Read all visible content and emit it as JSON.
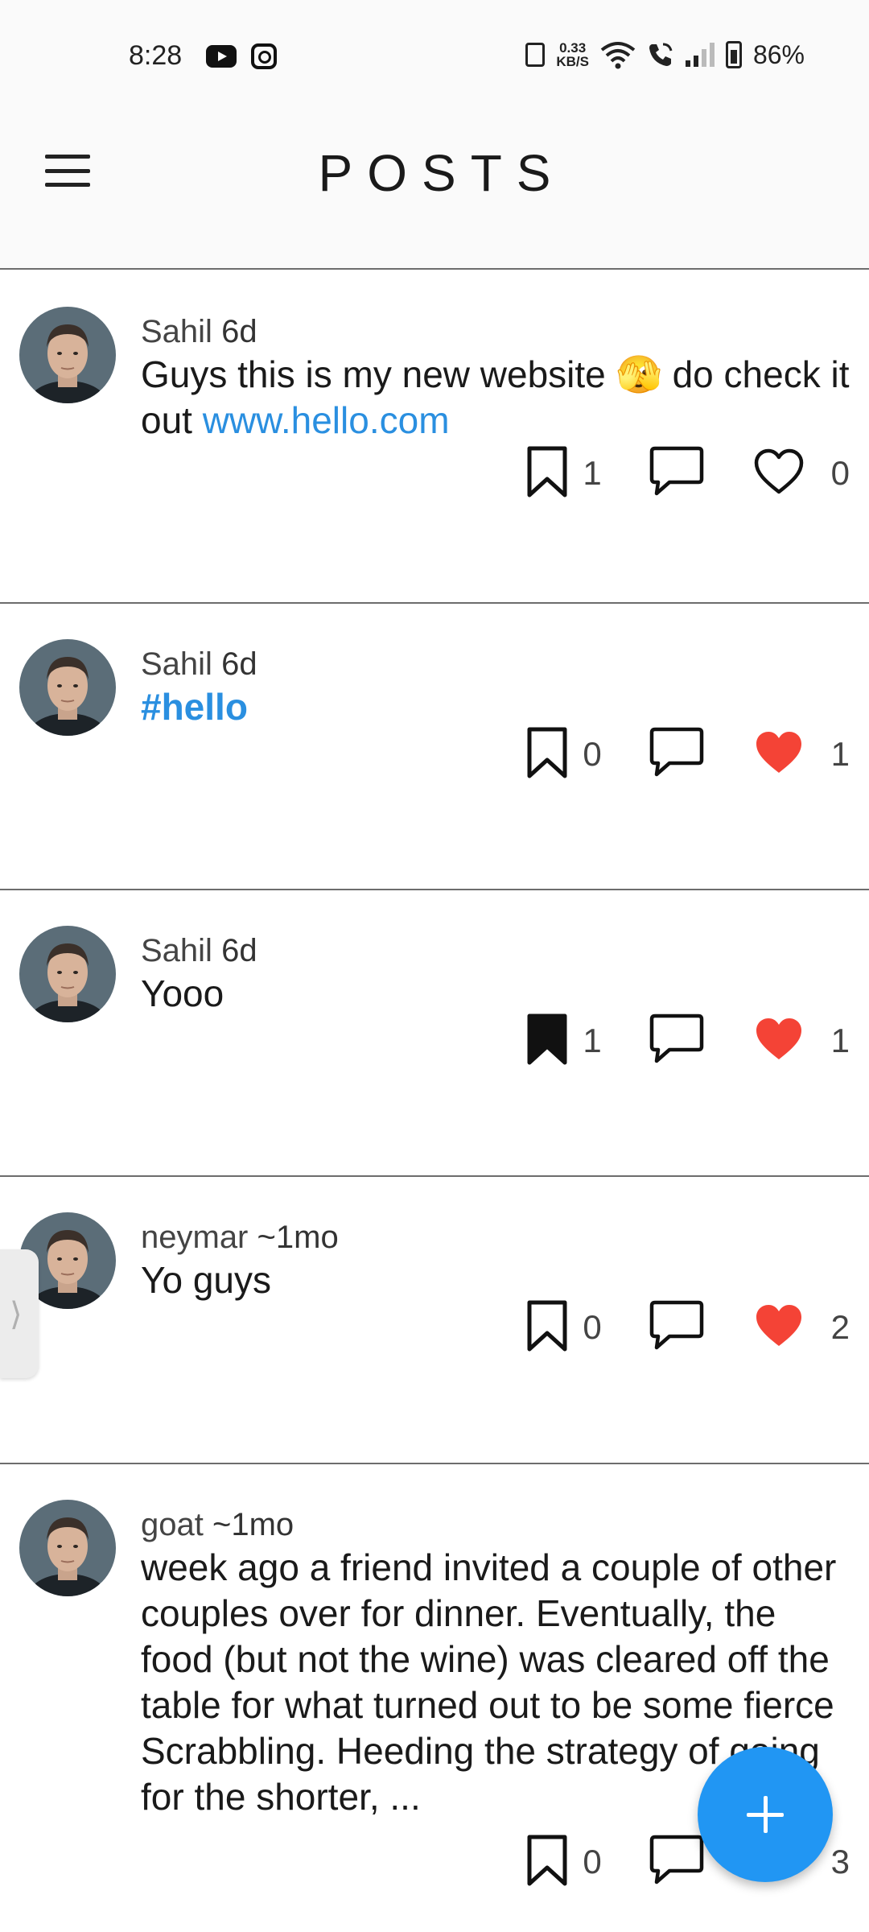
{
  "status_bar": {
    "time": "8:28",
    "net_speed_value": "0.33",
    "net_speed_unit": "KB/S",
    "battery": "86%",
    "icons": [
      "youtube-icon",
      "instagram-icon",
      "vibrate-icon",
      "wifi-icon",
      "wifi-call-icon",
      "signal-icon",
      "battery-icon"
    ]
  },
  "header": {
    "title": "POSTS",
    "menu_icon": "hamburger-menu-icon"
  },
  "colors": {
    "accent": "#2196f3",
    "link": "#2a8fe0",
    "like_active": "#f44336"
  },
  "posts": [
    {
      "author": "Sahil",
      "ago": "6d",
      "text_before": "Guys this is my new website 🫣 do check it out ",
      "link": "www.hello.com",
      "bookmarks": "1",
      "likes": "0",
      "bookmarked": false,
      "liked": false
    },
    {
      "author": "Sahil",
      "ago": "6d",
      "hashtag": "#hello",
      "bookmarks": "0",
      "likes": "1",
      "bookmarked": false,
      "liked": true
    },
    {
      "author": "Sahil",
      "ago": "6d",
      "text": "Yooo",
      "bookmarks": "1",
      "likes": "1",
      "bookmarked": true,
      "liked": true
    },
    {
      "author": "neymar",
      "ago": "~1mo",
      "text": "Yo guys",
      "bookmarks": "0",
      "likes": "2",
      "bookmarked": false,
      "liked": true
    },
    {
      "author": "goat",
      "ago": "~1mo",
      "text": "week ago a friend invited a couple of other couples over for dinner. Eventually, the food (but not the wine) was cleared off the table for what turned out to be some fierce Scrabbling. Heeding the strategy of going for the shorter, ...",
      "bookmarks": "0",
      "likes": "3",
      "bookmarked": false,
      "liked": true
    }
  ],
  "fab": {
    "icon": "plus-icon"
  },
  "side_handle": {
    "glyph": "⟩"
  }
}
